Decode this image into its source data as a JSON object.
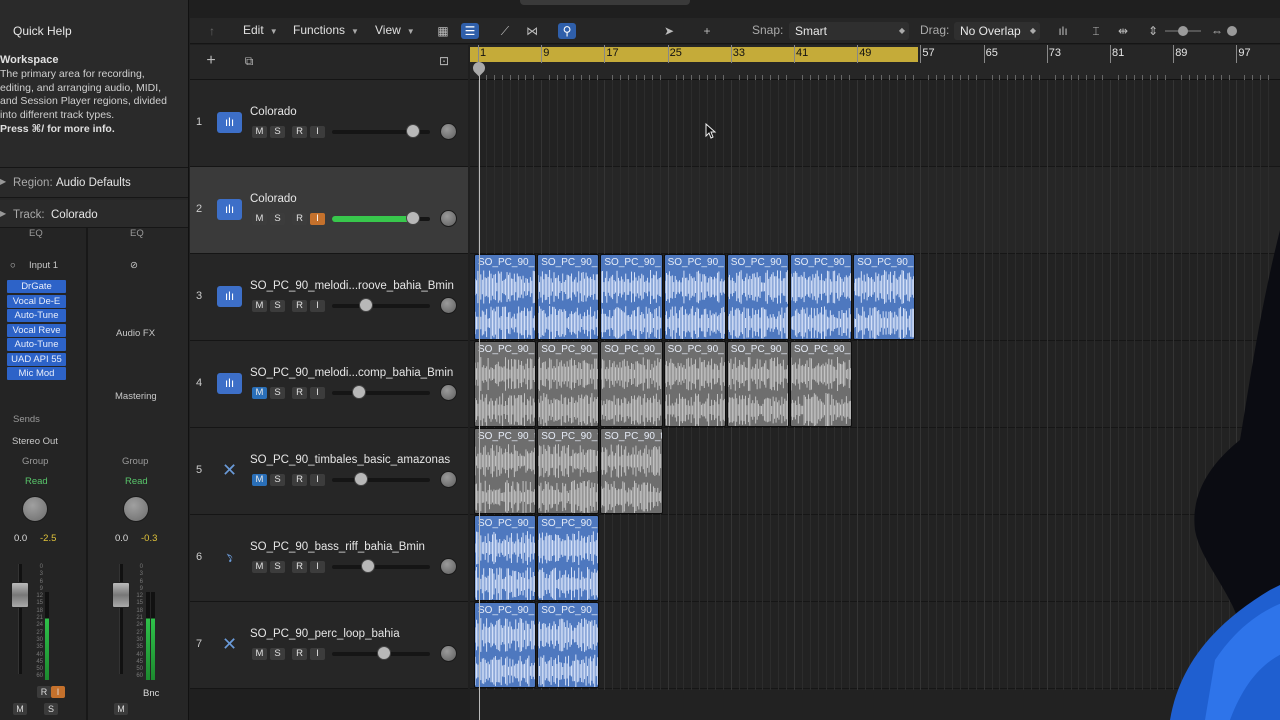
{
  "inspector": {
    "quick_help": {
      "title": "Quick Help",
      "heading": "Workspace",
      "text": "The primary area for recording, editing, and arranging audio, MIDI, and Session Player regions, divided into different track types.",
      "more": "Press ⌘/ for more info."
    },
    "region": {
      "label": "Region:",
      "value": "Audio Defaults"
    },
    "track": {
      "label": "Track:",
      "value": "Colorado"
    },
    "strip_a": {
      "eq": "EQ",
      "input": "Input 1",
      "plugins": [
        "DrGate",
        "Vocal De-E",
        "Auto-Tune",
        "Vocal Reve",
        "Auto-Tune",
        "UAD API 55",
        "Mic Mod"
      ],
      "sends": "Sends",
      "output": "Stereo Out",
      "group": "Group",
      "automation": "Read",
      "vol": "0.0",
      "peak": "-2.5",
      "r": "R",
      "i": "I",
      "m": "M",
      "s": "S"
    },
    "strip_b": {
      "eq": "EQ",
      "audio_fx": "Audio FX",
      "mastering": "Mastering",
      "group": "Group",
      "automation": "Read",
      "vol": "0.0",
      "peak": "-0.3",
      "bnc": "Bnc",
      "m": "M"
    },
    "scale": [
      "0",
      "3",
      "6",
      "9",
      "12",
      "15",
      "18",
      "21",
      "24",
      "27",
      "30",
      "35",
      "40",
      "45",
      "50",
      "60"
    ]
  },
  "toolbar": {
    "edit": "Edit",
    "functions": "Functions",
    "view": "View",
    "snap_label": "Snap:",
    "snap_value": "Smart",
    "drag_label": "Drag:",
    "drag_value": "No Overlap"
  },
  "ruler": {
    "bars": [
      "1",
      "9",
      "17",
      "25",
      "33",
      "41",
      "49",
      "57",
      "65",
      "73",
      "81",
      "89",
      "97"
    ]
  },
  "buttons": {
    "mute": "M",
    "solo": "S",
    "record": "R",
    "input": "I"
  },
  "tracks": [
    {
      "num": "1",
      "name": "Colorado",
      "icon": "waveform-icon",
      "vol": 0.83,
      "selected": false
    },
    {
      "num": "2",
      "name": "Colorado",
      "icon": "waveform-icon",
      "vol": 0.83,
      "selected": true,
      "vol_active": true,
      "input_on": true
    },
    {
      "num": "3",
      "name": "SO_PC_90_melodi...roove_bahia_Bmin",
      "icon": "waveform-icon",
      "vol": 0.35
    },
    {
      "num": "4",
      "name": "SO_PC_90_melodi...comp_bahia_Bmin",
      "icon": "waveform-icon",
      "vol": 0.28,
      "muted": true
    },
    {
      "num": "5",
      "name": "SO_PC_90_timbales_basic_amazonas",
      "icon": "drums-icon",
      "vol": 0.3,
      "muted": true
    },
    {
      "num": "6",
      "name": "SO_PC_90_bass_riff_bahia_Bmin",
      "icon": "guitar-icon",
      "vol": 0.37
    },
    {
      "num": "7",
      "name": "SO_PC_90_perc_loop_bahia",
      "icon": "drums-icon",
      "vol": 0.53
    }
  ],
  "regions": [
    {
      "track": 2,
      "label": "SO_PC_90_",
      "color": "blue",
      "count": 7
    },
    {
      "track": 3,
      "label": "SO_PC_90_",
      "color": "grey",
      "count": 6
    },
    {
      "track": 4,
      "label": "SO_PC_90_t",
      "color": "grey",
      "count": 3
    },
    {
      "track": 5,
      "label": "SO_PC_90_",
      "color": "blue",
      "count": 2
    },
    {
      "track": 6,
      "label": "SO_PC_90_",
      "color": "blue",
      "count": 2
    }
  ],
  "colors": {
    "cycle": "#c5ab39",
    "region_blue": "#4e78bf",
    "region_grey": "#6e6e6e",
    "accent": "#2f5faa",
    "meter": "#2fc24a"
  }
}
